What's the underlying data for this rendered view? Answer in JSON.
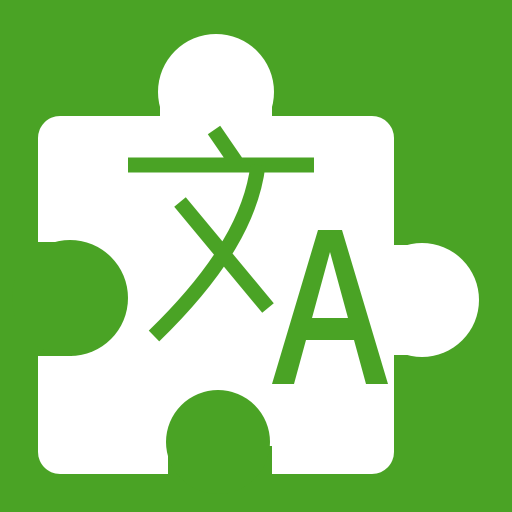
{
  "icon": {
    "name": "translate-extension-icon",
    "background_color": "#4aa325",
    "puzzle_color": "#ffffff",
    "glyph_color": "#4aa325",
    "glyphs": [
      "文",
      "A"
    ]
  }
}
